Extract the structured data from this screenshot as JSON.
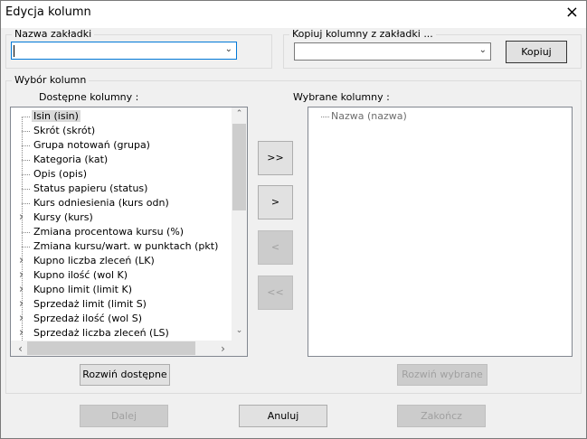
{
  "window": {
    "title": "Edycja kolumn",
    "close_icon": "×"
  },
  "tab_name": {
    "legend": "Nazwa zakładki",
    "value": ""
  },
  "copy_from": {
    "legend": "Kopiuj kolumny z zakładki ...",
    "value": "",
    "button": "Kopiuj"
  },
  "selection": {
    "legend": "Wybór kolumn",
    "available_label": "Dostępne kolumny :",
    "selected_label": "Wybrane kolumny :",
    "available": [
      "Isin (isin)",
      "Skrót (skrót)",
      "Grupa notowań (grupa)",
      "Kategoria (kat)",
      "Opis (opis)",
      "Status papieru (status)",
      "Kurs odniesienia (kurs odn)",
      "Kursy (kurs)",
      "Zmiana procentowa kursu (%)",
      "Zmiana kursu/wart. w punktach (pkt)",
      "Kupno liczba zleceń (LK)",
      "Kupno ilość (wol K)",
      "Kupno limit (limit K)",
      "Sprzedaż limit (limit S)",
      "Sprzedaż ilość (wol S)",
      "Sprzedaż liczba zleceń (LS)"
    ],
    "selected": [
      "Nazwa (nazwa)"
    ],
    "add_all": ">>",
    "add_one": ">",
    "remove_one": "<",
    "remove_all": "<<",
    "expand_available": "Rozwiń dostępne",
    "expand_selected": "Rozwiń wybrane"
  },
  "footer": {
    "next": "Dalej",
    "cancel": "Anuluj",
    "finish": "Zakończ"
  }
}
